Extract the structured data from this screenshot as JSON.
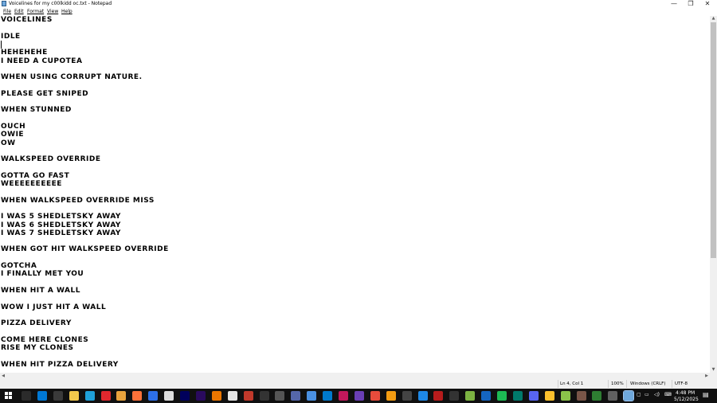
{
  "window": {
    "title": "Voicelines for my c00lkidd oc.txt - Notepad",
    "controls": [
      "—",
      "❐",
      "✕"
    ]
  },
  "menu": [
    "File",
    "Edit",
    "Format",
    "View",
    "Help"
  ],
  "lines": [
    "VOICELINES",
    "",
    "IDLE",
    "",
    "HEHEHEHE",
    "I NEED A CUPOTEA",
    "",
    "WHEN USING CORRUPT NATURE.",
    "",
    "PLEASE GET SNIPED",
    "",
    "WHEN STUNNED",
    "",
    "OUCH",
    "OWIE",
    "OW",
    "",
    "WALKSPEED OVERRIDE",
    "",
    "GOTTA GO FAST",
    "WEEEEEEEEEE",
    "",
    "WHEN WALKSPEED OVERRIDE MISS",
    "",
    "I WAS 5 SHEDLETSKY AWAY",
    "I WAS 6 SHEDLETSKY AWAY",
    "I WAS 7 SHEDLETSKY AWAY",
    "",
    "WHEN GOT HIT WALKSPEED OVERRIDE",
    "",
    "GOTCHA",
    "I FINALLY MET YOU",
    "",
    "WHEN HIT A WALL",
    "",
    "WOW I JUST HIT A WALL",
    "",
    "PIZZA DELIVERY",
    "",
    "COME HERE CLONES",
    "RISE MY CLONES",
    "",
    "WHEN HIT PIZZA DELIVERY"
  ],
  "status": {
    "position": "Ln 4, Col 1",
    "zoom": "100%",
    "line_ending": "Windows (CRLF)",
    "encoding": "UTF-8"
  },
  "taskbar": {
    "icons": [
      {
        "name": "task-view-icon",
        "color": "#2b2b2b"
      },
      {
        "name": "mail-icon",
        "color": "#0078d4"
      },
      {
        "name": "store-icon",
        "color": "#3a3a3a"
      },
      {
        "name": "file-explorer-icon",
        "color": "#f2c94c"
      },
      {
        "name": "edge-icon",
        "color": "#1fa0d8"
      },
      {
        "name": "opera-icon",
        "color": "#e0282e"
      },
      {
        "name": "chrome-icon",
        "color": "#e8a33d"
      },
      {
        "name": "firefox-icon",
        "color": "#ff7139"
      },
      {
        "name": "app-blue-icon",
        "color": "#2d6fe8"
      },
      {
        "name": "app-white-icon",
        "color": "#dddddd"
      },
      {
        "name": "animate-icon",
        "color": "#00005b"
      },
      {
        "name": "premiere-icon",
        "color": "#2a0a5e"
      },
      {
        "name": "blender-icon",
        "color": "#ea7600"
      },
      {
        "name": "app-tile-icon",
        "color": "#e6e6e6"
      },
      {
        "name": "game-icon",
        "color": "#c0392b"
      },
      {
        "name": "steam-dark-icon",
        "color": "#333333"
      },
      {
        "name": "obs-icon",
        "color": "#555555"
      },
      {
        "name": "app-grid-icon",
        "color": "#5566aa"
      },
      {
        "name": "gem-icon",
        "color": "#4a90e2"
      },
      {
        "name": "vscode-icon",
        "color": "#007acc"
      },
      {
        "name": "app-pink-icon",
        "color": "#c2185b"
      },
      {
        "name": "app-purple-icon",
        "color": "#6a3fb5"
      },
      {
        "name": "app-multicolor-icon",
        "color": "#e74c3c"
      },
      {
        "name": "app-orange-icon",
        "color": "#f39c12"
      },
      {
        "name": "media-player-icon",
        "color": "#444444"
      },
      {
        "name": "app-cyan-icon",
        "color": "#1e88e5"
      },
      {
        "name": "app-red-icon",
        "color": "#b71c1c"
      },
      {
        "name": "app-dark-icon",
        "color": "#333333"
      },
      {
        "name": "minecraft-icon",
        "color": "#7cb342"
      },
      {
        "name": "app-blue2-icon",
        "color": "#1565c0"
      },
      {
        "name": "spotify-icon",
        "color": "#1db954"
      },
      {
        "name": "app-teal-icon",
        "color": "#00796b"
      },
      {
        "name": "discord-icon",
        "color": "#5865f2"
      },
      {
        "name": "app-yellow-icon",
        "color": "#fbc02d"
      },
      {
        "name": "app-lime-icon",
        "color": "#8bc34a"
      },
      {
        "name": "app-brown-icon",
        "color": "#795548"
      },
      {
        "name": "app-green-icon",
        "color": "#2e7d32"
      },
      {
        "name": "app-gray-icon",
        "color": "#616161"
      },
      {
        "name": "notepad-icon",
        "color": "#6fa8dc"
      }
    ],
    "time": "4:48 PM",
    "date": "5/12/2025"
  }
}
